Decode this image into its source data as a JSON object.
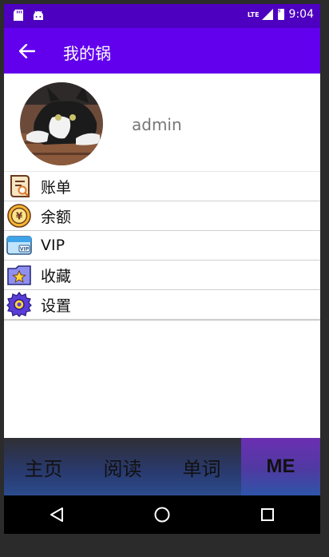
{
  "status_bar": {
    "time": "9:04",
    "network": "LTE",
    "icons": [
      "sd-card-icon",
      "android-icon",
      "signal-icon",
      "battery-icon"
    ]
  },
  "app_bar": {
    "title": "我的锅",
    "back_icon": "arrow-left-icon"
  },
  "profile": {
    "username": "admin",
    "avatar": "cat-photo"
  },
  "menu": {
    "items": [
      {
        "label": "账单",
        "icon": "bill-icon"
      },
      {
        "label": "余额",
        "icon": "coin-icon"
      },
      {
        "label": "VIP",
        "icon": "vip-card-icon"
      },
      {
        "label": "收藏",
        "icon": "favorite-folder-icon"
      },
      {
        "label": "设置",
        "icon": "gear-icon"
      }
    ]
  },
  "tabs": {
    "items": [
      {
        "label": "主页"
      },
      {
        "label": "阅读"
      },
      {
        "label": "单词"
      },
      {
        "label": "ME"
      }
    ],
    "active_index": 3
  },
  "nav_bar": {
    "buttons": [
      "back-triangle-icon",
      "home-circle-icon",
      "recents-square-icon"
    ]
  },
  "colors": {
    "status_bar": "#4d00c0",
    "app_bar": "#6200ee",
    "tab_bar": "#293a70",
    "active_tab": "#6b2fb2"
  }
}
